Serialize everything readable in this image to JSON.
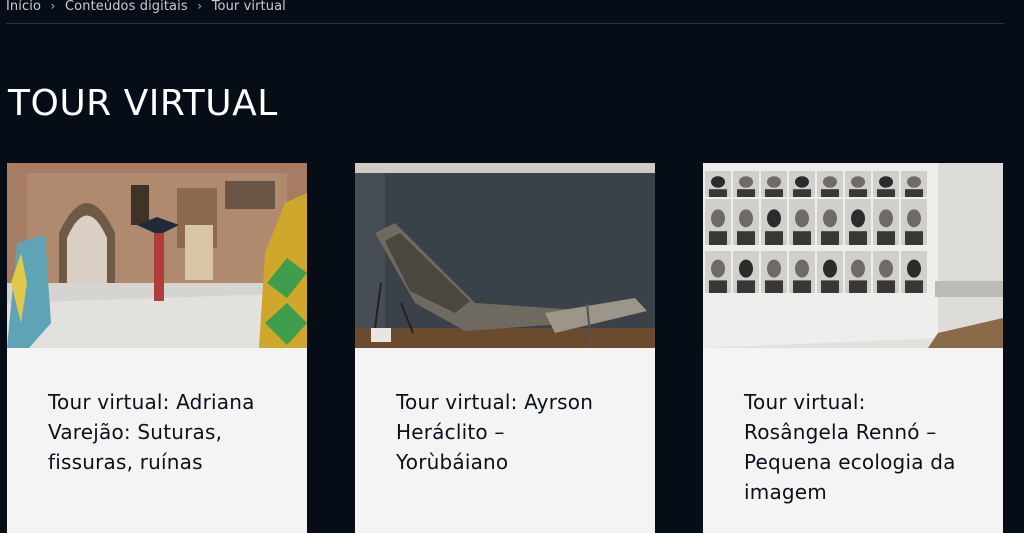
{
  "breadcrumb": {
    "items": [
      "Início",
      "Conteúdos digitais",
      "Tour virtual"
    ],
    "separator": "›"
  },
  "page": {
    "title": "TOUR VIRTUAL"
  },
  "cards": [
    {
      "title": "Tour virtual: Adriana Varejão: Suturas, fissuras, ruínas",
      "image_icon": "gallery-courtyard-image"
    },
    {
      "title": "Tour virtual: Ayrson Heráclito – Yorùbáiano",
      "image_icon": "boat-installation-image"
    },
    {
      "title": "Tour virtual: Rosângela Rennó – Pequena ecologia da imagem",
      "image_icon": "portrait-wall-image"
    }
  ],
  "colors": {
    "background": "#070d16",
    "card_background": "#f4f4f5",
    "title_text": "#ffffff",
    "card_text": "#0b111a"
  }
}
